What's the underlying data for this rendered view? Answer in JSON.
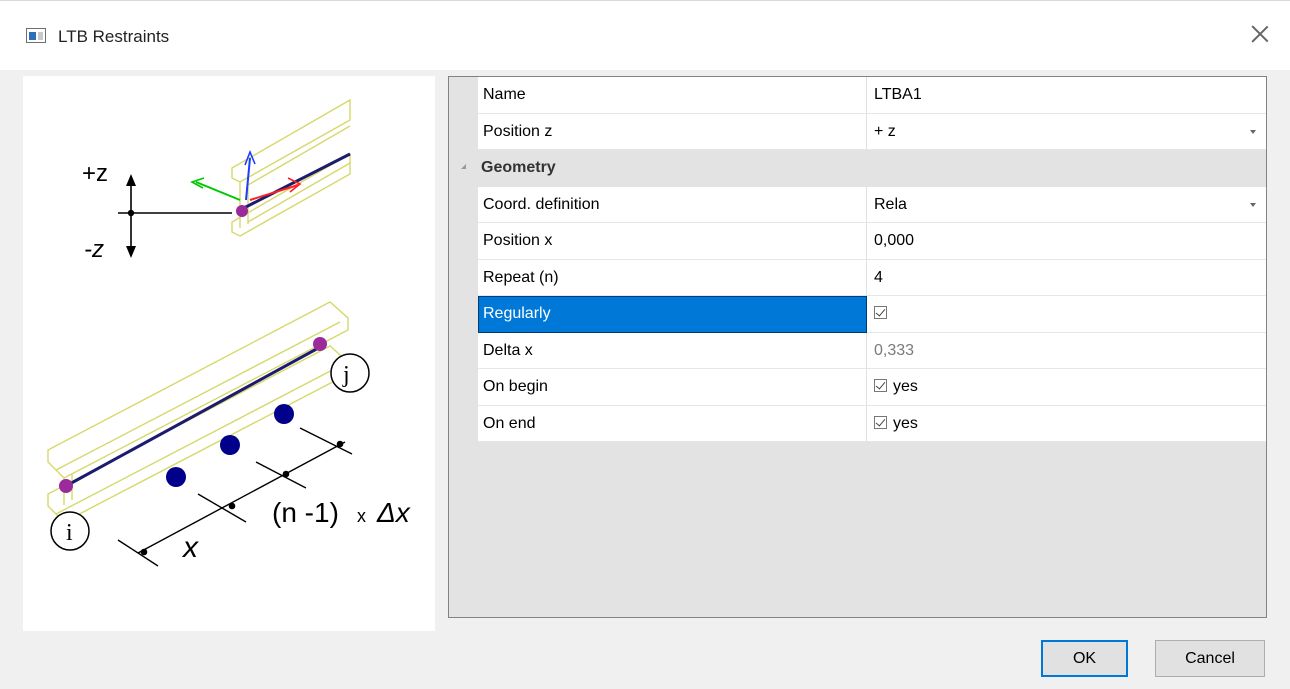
{
  "window": {
    "title": "LTB Restraints"
  },
  "diagram": {
    "plus_z": "+z",
    "minus_z": "-z",
    "node_i": "i",
    "node_j": "j",
    "x_label": "x",
    "spacing_label": "(n -1)",
    "spacing_times": "x",
    "spacing_delta": "Δx"
  },
  "properties": {
    "name": {
      "label": "Name",
      "value": "LTBA1"
    },
    "position_z": {
      "label": "Position z",
      "value": "+ z"
    },
    "geometry_category": "Geometry",
    "coord_definition": {
      "label": "Coord. definition",
      "value": "Rela"
    },
    "position_x": {
      "label": "Position x",
      "value": "0,000"
    },
    "repeat": {
      "label": "Repeat (n)",
      "value": "4"
    },
    "regularly": {
      "label": "Regularly",
      "checked": true
    },
    "delta_x": {
      "label": "Delta x",
      "value": "0,333"
    },
    "on_begin": {
      "label": "On begin",
      "value": "yes",
      "checked": true
    },
    "on_end": {
      "label": "On end",
      "value": "yes",
      "checked": true
    }
  },
  "buttons": {
    "ok": "OK",
    "cancel": "Cancel"
  },
  "colors": {
    "selection": "#0078d7",
    "beam": "#e4e47a",
    "restraint": "#00008b",
    "node": "#8b1a8b"
  }
}
